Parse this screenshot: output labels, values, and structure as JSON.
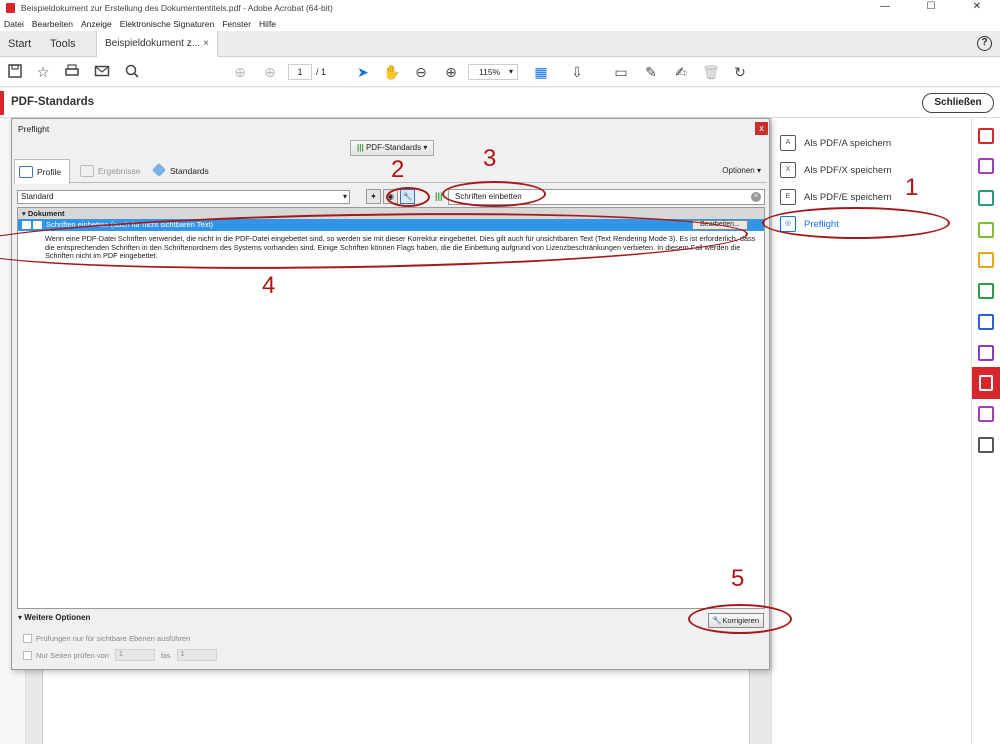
{
  "window": {
    "title": "Beispieldokument zur Erstellung des Dokumententitels.pdf - Adobe Acrobat (64-bit)",
    "controls": [
      "—",
      "☐",
      "✕"
    ]
  },
  "menu": [
    "Datei",
    "Bearbeiten",
    "Anzeige",
    "Elektronische Signaturen",
    "Fenster",
    "Hilfe"
  ],
  "tabs": {
    "start": "Start",
    "tools": "Tools",
    "doc": "Beispieldokument z...",
    "close": "×",
    "help": "?"
  },
  "toolbar": {
    "page_current": "1",
    "page_total": "/ 1",
    "zoom": "115%"
  },
  "header": {
    "title": "PDF-Standards",
    "close_button": "Schließen"
  },
  "right_panel": {
    "items": [
      {
        "label": "Als PDF/A speichern",
        "icon": "pdfa-icon"
      },
      {
        "label": "Als PDF/X speichern",
        "icon": "pdfx-icon"
      },
      {
        "label": "Als PDF/E speichern",
        "icon": "pdfe-icon"
      },
      {
        "label": "Preflight",
        "icon": "preflight-icon"
      }
    ]
  },
  "dialog": {
    "title": "Preflight",
    "close": "x",
    "pdf_standards_button": "PDF-Standards",
    "tabs": {
      "profile": "Profile",
      "results": "Ergebnisse",
      "standards": "Standards"
    },
    "options": "Optionen",
    "profile_select": "Standard",
    "search_value": "Schriften einbetten",
    "group": "Dokument",
    "row": {
      "title": "Schriften einbetten (auch für nicht sichtbaren Text)",
      "edit_button": "Bearbeiten...",
      "description": "Wenn eine PDF-Datei Schriften verwendet, die nicht in die PDF-Datei eingebettet sind, so werden sie mit dieser Korrektur eingebettet. Dies gilt auch für unsichtbaren Text (Text Rendering Mode 3). Es ist erforderlich, dass die entsprechenden Schriften in den Schriftenordnern des Systems vorhanden sind. Einige Schriften können Flags haben, die die Einbettung aufgrund von Lizenzbeschränkungen verbieten. In diesem Fall werden die Schriften nicht im PDF eingebettet."
    },
    "more_options": "Weitere Optionen",
    "fix_button": "Korrigieren",
    "opt1": "Prüfungen nur für sichtbare Ebenen ausführen",
    "opt2_label": "Nur Seiten prüfen von",
    "opt2_from": "1",
    "opt2_bis": "bis",
    "opt2_to": "1"
  },
  "annotations": [
    "1",
    "2",
    "3",
    "4",
    "5"
  ],
  "colors": {
    "accent_red": "#d7262c",
    "annotation": "#a41a1a",
    "selection_blue": "#3295e8",
    "link_blue": "#1473e6"
  }
}
